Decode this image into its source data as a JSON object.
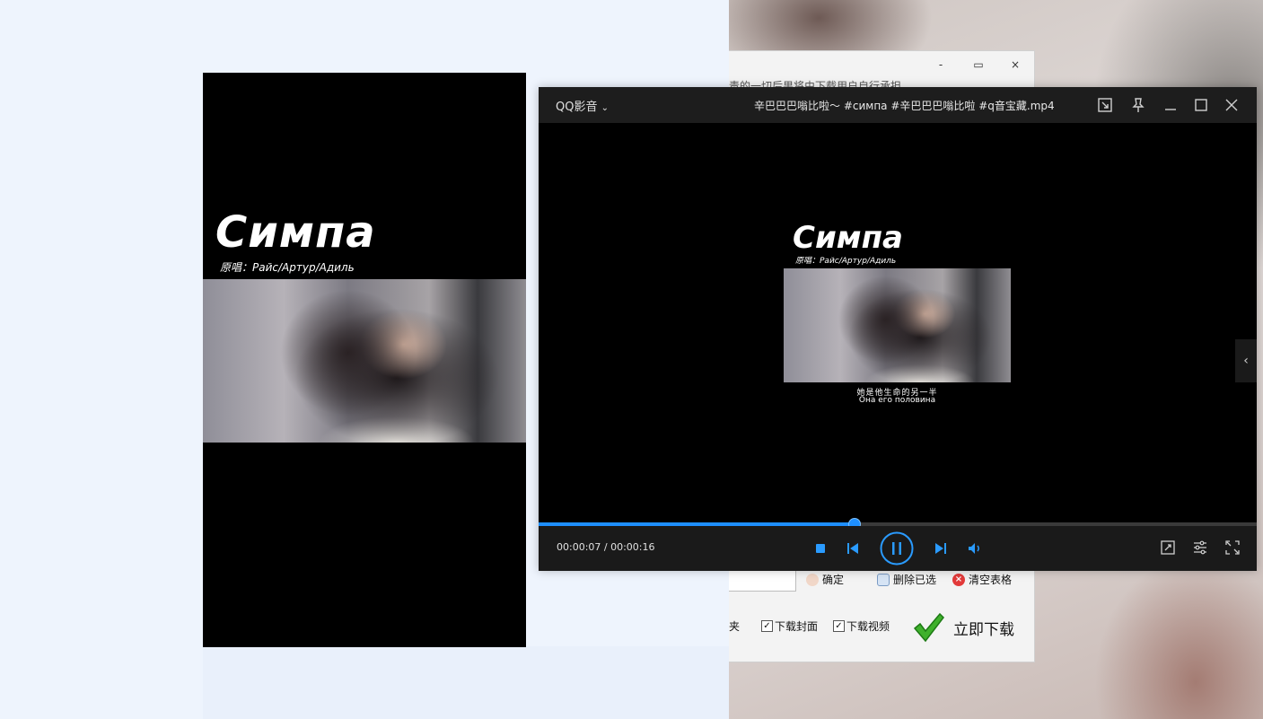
{
  "dialog": {
    "note": "责的一切后果将由下载用户自行承担。",
    "minimize": "-",
    "maximize": "▭",
    "close": "×",
    "confirm_label": "确定",
    "delete_selected_label": "删除已选",
    "clear_table_label": "清空表格",
    "folder_label": "夹",
    "download_cover_label": "下载封面",
    "download_cover_checked": true,
    "download_video_label": "下载视频",
    "download_video_checked": true,
    "download_now_label": "立即下载"
  },
  "phone_preview": {
    "title": "Симпа",
    "singer_line": "原唱：Райс/Артур/Адиль"
  },
  "player": {
    "brand": "QQ影音",
    "file_title": "辛巴巴巴嗡比啦～ #симпа #辛巴巴巴嗡比啦 #q音宝藏.mp4",
    "video_title": "Симпа",
    "video_singer_line": "原唱：Райс/Артур/Адиль",
    "caption_cn": "她是他生命的另一半",
    "caption_ru": "Она его половина",
    "time_current": "00:00:07",
    "time_total": "00:00:16",
    "time_display": "00:00:07 / 00:00:16",
    "progress": 0.44,
    "accent_color": "#1e8fff",
    "icons": {
      "brand_menu": "chevron-down-icon",
      "picture_in_picture": "mini-window-icon",
      "pin": "pin-icon",
      "minimize": "minimize-icon",
      "maximize": "maximize-icon",
      "close": "close-icon",
      "side_panel": "chevron-left-icon",
      "stop": "stop-icon",
      "previous": "previous-icon",
      "pause": "pause-icon",
      "next": "next-icon",
      "volume": "volume-icon",
      "screenshot": "screenshot-icon",
      "settings": "settings-icon",
      "fullscreen": "fullscreen-icon"
    }
  }
}
